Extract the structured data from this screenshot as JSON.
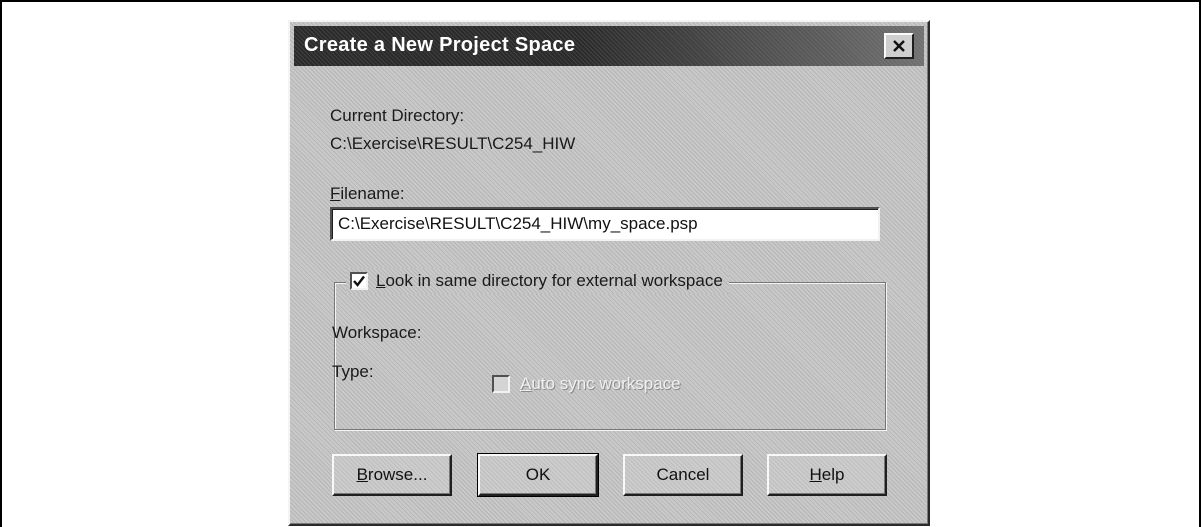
{
  "dialog": {
    "title": "Create a New Project Space",
    "close_icon": "close-x-icon"
  },
  "current_directory": {
    "label": "Current Directory:",
    "value": "C:\\Exercise\\RESULT\\C254_HIW"
  },
  "filename": {
    "label_mnemonic": "F",
    "label_rest": "ilename:",
    "value": "C:\\Exercise\\RESULT\\C254_HIW\\my_space.psp"
  },
  "external_workspace": {
    "checked": true,
    "label_mnemonic": "L",
    "label_rest": "ook in same directory for external workspace",
    "workspace_label": "Workspace:",
    "type_label": "Type:",
    "auto_sync": {
      "checked": false,
      "enabled": false,
      "label_mnemonic": "A",
      "label_rest": "uto sync workspace"
    }
  },
  "buttons": {
    "browse": {
      "mnemonic": "B",
      "rest": "rowse..."
    },
    "ok": {
      "label": "OK"
    },
    "cancel": {
      "label": "Cancel"
    },
    "help": {
      "mnemonic": "H",
      "rest": "elp"
    }
  }
}
